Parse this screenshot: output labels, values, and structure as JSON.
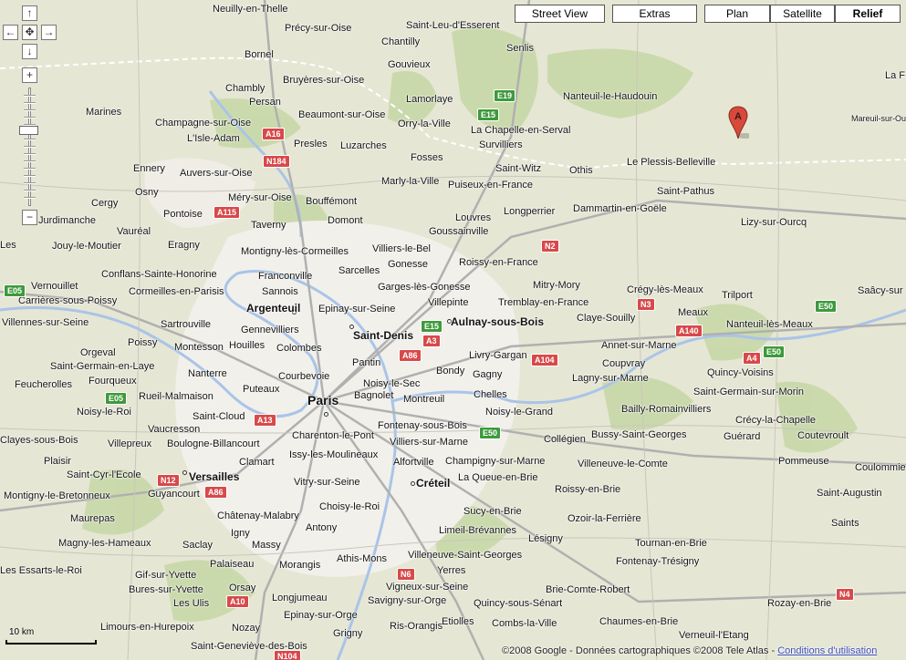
{
  "map_types": {
    "street_view": "Street View",
    "extras": "Extras",
    "plan": "Plan",
    "satellite": "Satellite",
    "relief": "Relief",
    "active": "Relief"
  },
  "controls": {
    "pan_up": "↑",
    "pan_left": "←",
    "pan_center": "✥",
    "pan_right": "→",
    "pan_down": "↓",
    "zoom_in": "+",
    "zoom_out": "−"
  },
  "marker": {
    "letter": "A",
    "color": "#d6493b"
  },
  "scale": {
    "label": "10 km"
  },
  "copyright": {
    "text": "©2008 Google - Données cartographiques ©2008 Tele Atlas -",
    "link": "Conditions d'utilisation"
  },
  "colors": {
    "terrain": "#e6e6d4",
    "urban": "#f2f0ea",
    "forest": "#c8d8a8",
    "water": "#a9c4e8",
    "road_major": "#b0b0b0",
    "shield_red": "#d8494a",
    "shield_green": "#3e9a3c"
  },
  "capital": "Paris",
  "cities": [
    "Argenteuil",
    "Saint-Denis",
    "Aulnay-sous-Bois",
    "Versailles",
    "Créteil"
  ],
  "places": [
    "Neuilly-en-Thelle",
    "Précy-sur-Oise",
    "Saint-Leu-d'Esserent",
    "Senlis",
    "Chantilly",
    "Gouvieux",
    "Bornel",
    "Chambly",
    "Bruyères-sur-Oise",
    "Lamorlaye",
    "Nanteuil-le-Haudouin",
    "La F",
    "Marines",
    "Persan",
    "Beaumont-sur-Oise",
    "Orry-la-Ville",
    "Mareuil-sur-Ourcq",
    "Champagne-sur-Oise",
    "La Chapelle-en-Serval",
    "L'Isle-Adam",
    "Presles",
    "Luzarches",
    "Survilliers",
    "Fosses",
    "Othis",
    "Le Plessis-Belleville",
    "Ennery",
    "Auvers-sur-Oise",
    "Saint-Witz",
    "Marly-la-Ville",
    "Puiseux-en-France",
    "Osny",
    "Méry-sur-Oise",
    "Bouffémont",
    "Saint-Pathus",
    "Cergy",
    "Pontoise",
    "Dammartin-en-Goële",
    "Longperrier",
    "Jurdimanche",
    "Taverny",
    "Domont",
    "Louvres",
    "Lizy-sur-Ourcq",
    "Vauréal",
    "Goussainville",
    "Les",
    "Jouy-le-Moutier",
    "Eragny",
    "Montigny-lès-Cormeilles",
    "Villiers-le-Bel",
    "Gonesse",
    "Roissy-en-France",
    "Sarcelles",
    "Conflans-Sainte-Honorine",
    "Franconville",
    "Vernouillet",
    "Mitry-Mory",
    "Saâcy-sur",
    "Carrières-sous-Poissy",
    "Cormeilles-en-Parisis",
    "Sannois",
    "Garges-lès-Gonesse",
    "Crégy-lès-Meaux",
    "Trilport",
    "Epinay-sur-Seine",
    "Villepinte",
    "Tremblay-en-France",
    "Villennes-sur-Seine",
    "Gennevilliers",
    "Claye-Souilly",
    "Meaux",
    "Nanteuil-lès-Meaux",
    "Sartrouville",
    "Poissy",
    "Montesson",
    "Houilles",
    "Colombes",
    "Annet-sur-Marne",
    "Orgeval",
    "Livry-Gargan",
    "Pantin",
    "Saint-Germain-en-Laye",
    "Courbevoie",
    "Quincy-Voisins",
    "Fourqueux",
    "Bondy",
    "Gagny",
    "Coupvray",
    "Feucherolles",
    "Nanterre",
    "Noisy-le-Sec",
    "Lagny-sur-Marne",
    "Rueil-Malmaison",
    "Puteaux",
    "Bagnolet",
    "Montreuil",
    "Chelles",
    "Saint-Germain-sur-Morin",
    "Noisy-le-Roi",
    "Bailly-Romainvilliers",
    "Noisy-le-Grand",
    "Crécy-la-Chapelle",
    "Saint-Cloud",
    "Charenton-le-Pont",
    "Vaucresson",
    "Fontenay-sous-Bois",
    "Guérard",
    "Coutevroult",
    "Clayes-sous-Bois",
    "Villepreux",
    "Boulogne-Billancourt",
    "Villiers-sur-Marne",
    "Collégien",
    "Bussy-Saint-Georges",
    "Issy-les-Moulineaux",
    "Pommeuse",
    "Plaisir",
    "Clamart",
    "Champigny-sur-Marne",
    "Alfortville",
    "Villeneuve-le-Comte",
    "Coulommie",
    "Saint-Cyr-l'Ecole",
    "Vitry-sur-Seine",
    "La Queue-en-Brie",
    "Montigny-le-Bretonneux",
    "Guyancourt",
    "Roissy-en-Brie",
    "Saint-Augustin",
    "Choisy-le-Roi",
    "Sucy-en-Brie",
    "Châtenay-Malabry",
    "Ozoir-la-Ferrière",
    "Maurepas",
    "Antony",
    "Limeil-Brévannes",
    "Saints",
    "Igny",
    "Lésigny",
    "Magny-les-Hameaux",
    "Saclay",
    "Massy",
    "Tournan-en-Brie",
    "Villeneuve-Saint-Georges",
    "Athis-Mons",
    "Fontenay-Trésigny",
    "Les Essarts-le-Roi",
    "Palaiseau",
    "Morangis",
    "Yerres",
    "Gif-sur-Yvette",
    "Orsay",
    "Brie-Comte-Robert",
    "Bures-sur-Yvette",
    "Vigneux-sur-Seine",
    "Longjumeau",
    "Savigny-sur-Orge",
    "Les Ulis",
    "Quincy-sous-Sénart",
    "Rozay-en-Brie",
    "Chaumes-en-Brie",
    "Limours-en-Hurepoix",
    "Epinay-sur-Orge",
    "Combs-la-Ville",
    "Nozay",
    "Ris-Orangis",
    "Etiolles",
    "Verneuil-l'Etang",
    "Grigny",
    "Saint-Geneviève-des-Bois"
  ],
  "road_shields": {
    "red": [
      "A16",
      "N184",
      "A115",
      "N2",
      "N3",
      "A140",
      "A4",
      "A86",
      "A3",
      "A104",
      "A13",
      "N12",
      "A86",
      "N6",
      "A10",
      "N4",
      "N104"
    ],
    "green": [
      "E19",
      "E15",
      "E05",
      "E15",
      "E50",
      "E50",
      "E05",
      "E50"
    ]
  }
}
